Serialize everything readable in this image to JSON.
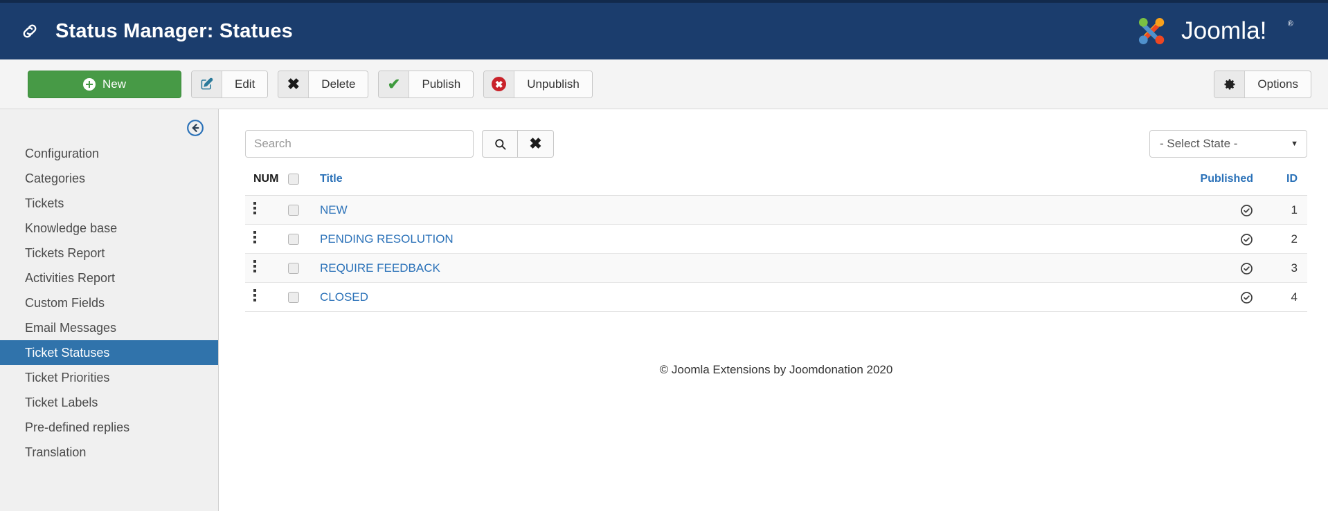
{
  "header": {
    "title": "Status Manager: Statues",
    "link_icon": "chain-icon",
    "brand": "Joomla!",
    "brand_registered": "®",
    "bg_color": "#1b3d6d"
  },
  "toolbar": {
    "new_label": "New",
    "new_color": "#479a46",
    "buttons": [
      {
        "label": "Edit",
        "icon": "pencil-square-icon"
      },
      {
        "label": "Delete",
        "icon": "x-mark-icon"
      },
      {
        "label": "Publish",
        "icon": "check-mark-icon"
      },
      {
        "label": "Unpublish",
        "icon": "circle-x-icon"
      }
    ],
    "options_label": "Options",
    "options_icon": "gear-icon"
  },
  "sidebar": {
    "collapse_icon": "circle-arrow-left-icon",
    "items": [
      {
        "label": "Configuration",
        "active": false
      },
      {
        "label": "Categories",
        "active": false
      },
      {
        "label": "Tickets",
        "active": false
      },
      {
        "label": "Knowledge base",
        "active": false
      },
      {
        "label": "Tickets Report",
        "active": false
      },
      {
        "label": "Activities Report",
        "active": false
      },
      {
        "label": "Custom Fields",
        "active": false
      },
      {
        "label": "Email Messages",
        "active": false
      },
      {
        "label": "Ticket Statuses",
        "active": true
      },
      {
        "label": "Ticket Priorities",
        "active": false
      },
      {
        "label": "Ticket Labels",
        "active": false
      },
      {
        "label": "Pre-defined replies",
        "active": false
      },
      {
        "label": "Translation",
        "active": false
      }
    ],
    "active_color": "#3073ab"
  },
  "filters": {
    "search_value": "",
    "search_placeholder": "Search",
    "search_button_icon": "magnifier-icon",
    "clear_button_icon": "x-mark-icon",
    "select_state_value": "- Select State -",
    "select_state_caret": "▼"
  },
  "table": {
    "columns": {
      "num": "NUM",
      "title": "Title",
      "published": "Published",
      "id": "ID"
    },
    "rows": [
      {
        "title": "NEW",
        "published_icon": "published-check-icon",
        "id": "1"
      },
      {
        "title": "PENDING RESOLUTION",
        "published_icon": "published-check-icon",
        "id": "2"
      },
      {
        "title": "REQUIRE FEEDBACK",
        "published_icon": "published-check-icon",
        "id": "3"
      },
      {
        "title": "CLOSED",
        "published_icon": "published-check-icon",
        "id": "4"
      }
    ]
  },
  "footer": {
    "copyright": "© Joomla Extensions by Joomdonation 2020"
  }
}
